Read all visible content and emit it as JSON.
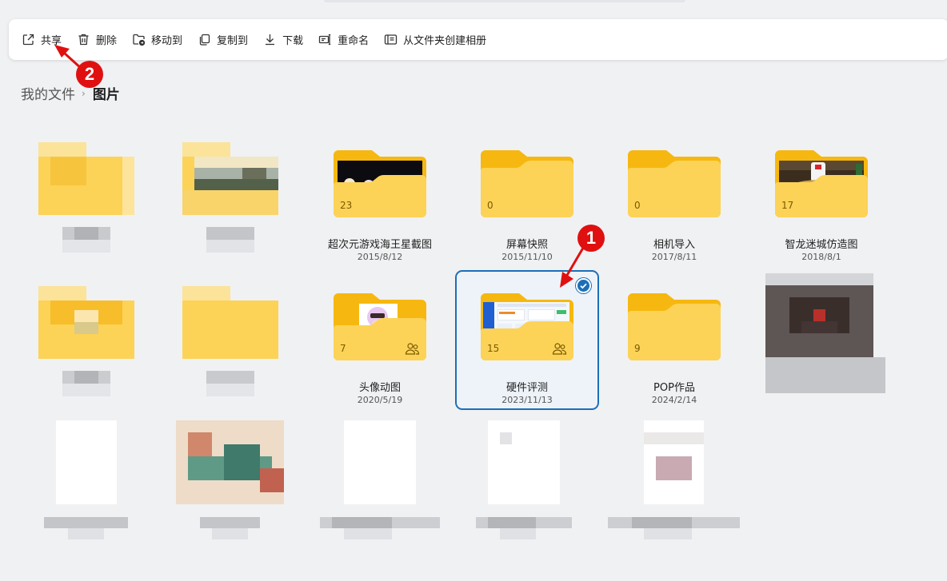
{
  "toolbar": {
    "items": [
      {
        "label": "共享",
        "icon": "share-icon"
      },
      {
        "label": "删除",
        "icon": "trash-icon"
      },
      {
        "label": "移动到",
        "icon": "move-folder-icon"
      },
      {
        "label": "复制到",
        "icon": "copy-icon"
      },
      {
        "label": "下载",
        "icon": "download-icon"
      },
      {
        "label": "重命名",
        "icon": "rename-icon"
      },
      {
        "label": "从文件夹创建相册",
        "icon": "album-icon"
      }
    ]
  },
  "breadcrumb": {
    "root": "我的文件",
    "separator": "›",
    "current": "图片"
  },
  "folders": [
    {
      "name": "超次元游戏海王星截图",
      "date": "2015/8/12",
      "count": "23",
      "preview": "dark-game",
      "shared": false
    },
    {
      "name": "屏幕快照",
      "date": "2015/11/10",
      "count": "0",
      "preview": "none",
      "shared": false
    },
    {
      "name": "相机导入",
      "date": "2017/8/11",
      "count": "0",
      "preview": "none",
      "shared": false
    },
    {
      "name": "智龙迷城仿造图",
      "date": "2018/8/1",
      "count": "17",
      "preview": "game-stage",
      "shared": false
    },
    {
      "name": "头像动图",
      "date": "2020/5/19",
      "count": "7",
      "preview": "avatar",
      "shared": true
    },
    {
      "name": "硬件评测",
      "date": "2023/11/13",
      "count": "15",
      "preview": "dashboard",
      "shared": true,
      "selected": true
    },
    {
      "name": "POP作品",
      "date": "2024/2/14",
      "count": "9",
      "preview": "none",
      "shared": false
    }
  ],
  "callouts": [
    "1",
    "2"
  ],
  "colors": {
    "accent": "#1c6fb7",
    "folder_back": "#f6b810",
    "folder_front": "#fcd357",
    "callout": "#e01010"
  }
}
